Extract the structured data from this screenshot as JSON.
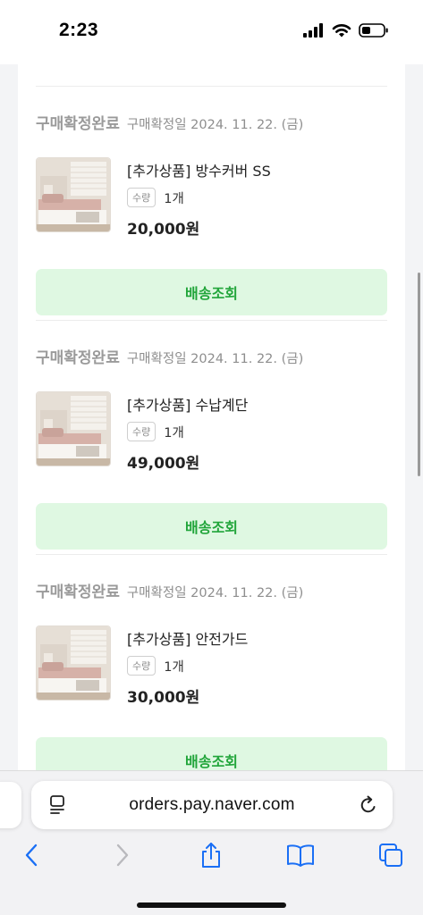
{
  "status_bar": {
    "time": "2:23",
    "icons": [
      "cellular-signal-icon",
      "wifi-icon",
      "battery-icon"
    ]
  },
  "orders": [
    {
      "status": "구매확정완료",
      "date_text": "구매확정일 2024. 11. 22. (금)",
      "product_name": "[추가상품] 방수커버 SS",
      "quantity_label": "수량",
      "quantity": "1개",
      "price": "20,000원",
      "button_label": "배송조회"
    },
    {
      "status": "구매확정완료",
      "date_text": "구매확정일 2024. 11. 22. (금)",
      "product_name": "[추가상품] 수납계단",
      "quantity_label": "수량",
      "quantity": "1개",
      "price": "49,000원",
      "button_label": "배송조회"
    },
    {
      "status": "구매확정완료",
      "date_text": "구매확정일 2024. 11. 22. (금)",
      "product_name": "[추가상품] 안전가드",
      "quantity_label": "수량",
      "quantity": "1개",
      "price": "30,000원",
      "button_label": "배송조회"
    }
  ],
  "browser": {
    "url": "orders.pay.naver.com",
    "toolbar_icons": [
      "back-icon",
      "forward-icon",
      "share-icon",
      "bookmarks-icon",
      "tabs-icon"
    ],
    "accent_color": "#1a6ff5",
    "disabled_color": "#b9b9bd"
  },
  "colors": {
    "button_bg": "#dff8e2",
    "button_text": "#21a53a",
    "status_text": "#9a9a9a"
  }
}
